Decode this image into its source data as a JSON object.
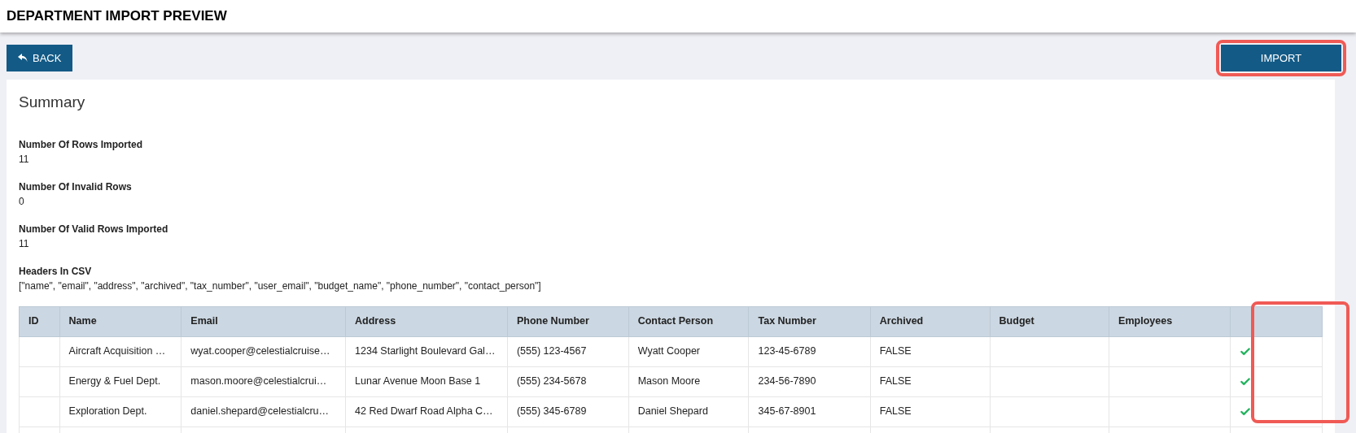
{
  "page_title": "DEPARTMENT IMPORT PREVIEW",
  "back_button": {
    "label": "BACK"
  },
  "import_button": {
    "label": "IMPORT",
    "highlighted": true
  },
  "summary": {
    "title": "Summary",
    "fields": [
      {
        "label": "Number Of Rows Imported",
        "value": "11"
      },
      {
        "label": "Number Of Invalid Rows",
        "value": "0"
      },
      {
        "label": "Number Of Valid Rows Imported",
        "value": "11"
      },
      {
        "label": "Headers In CSV",
        "value": "[\"name\", \"email\", \"address\", \"archived\", \"tax_number\", \"user_email\", \"budget_name\", \"phone_number\", \"contact_person\"]"
      }
    ]
  },
  "table": {
    "columns": [
      "ID",
      "Name",
      "Email",
      "Address",
      "Phone Number",
      "Contact Person",
      "Tax Number",
      "Archived",
      "Budget",
      "Employees"
    ],
    "status_column_highlighted": true,
    "rows": [
      {
        "cells": [
          "",
          "Aircraft Acquisition …",
          "wyat.cooper@celestialcruise…",
          "1234 Starlight Boulevard Gal…",
          "(555) 123-4567",
          "Wyatt Cooper",
          "123-45-6789",
          "FALSE",
          "",
          ""
        ],
        "valid": true
      },
      {
        "cells": [
          "",
          "Energy & Fuel Dept.",
          "mason.moore@celestialcrui…",
          "Lunar Avenue Moon Base 1",
          "(555) 234-5678",
          "Mason Moore",
          "234-56-7890",
          "FALSE",
          "",
          ""
        ],
        "valid": true
      },
      {
        "cells": [
          "",
          "Exploration Dept.",
          "daniel.shepard@celestialcru…",
          "42 Red Dwarf Road Alpha C…",
          "(555) 345-6789",
          "Daniel Shepard",
          "345-67-8901",
          "FALSE",
          "",
          ""
        ],
        "valid": true
      }
    ]
  }
}
